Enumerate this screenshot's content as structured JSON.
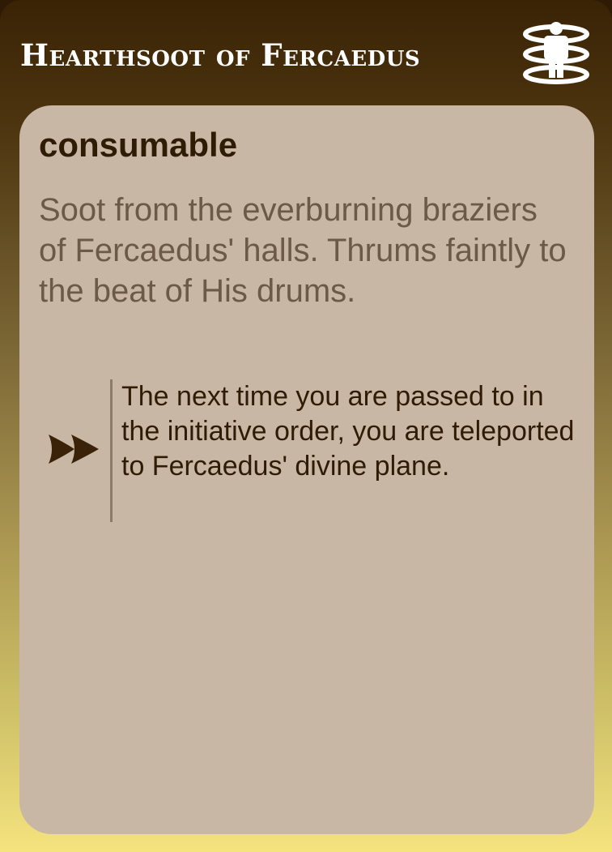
{
  "card": {
    "title": "Hearthsoot of Fercaedus",
    "type_icon": "teleport-person-icon",
    "category": "consumable",
    "flavor_text": "Soot from the everburning braziers of Fercaedus' halls. Thrums faintly to the beat of His drums.",
    "effect": {
      "icon": "fast-forward-icon",
      "text": "The next time you are passed to in the initiative order, you are teleported to Fercaedus' divine plane."
    }
  },
  "colors": {
    "gradient_top": "#3a2305",
    "gradient_bottom": "#f5e37e",
    "panel": "#c9b7a5",
    "title_text": "#ffffff",
    "dark_text": "#2e1c05",
    "flavor_text": "#6b5a47",
    "divider": "#8c7b68"
  }
}
